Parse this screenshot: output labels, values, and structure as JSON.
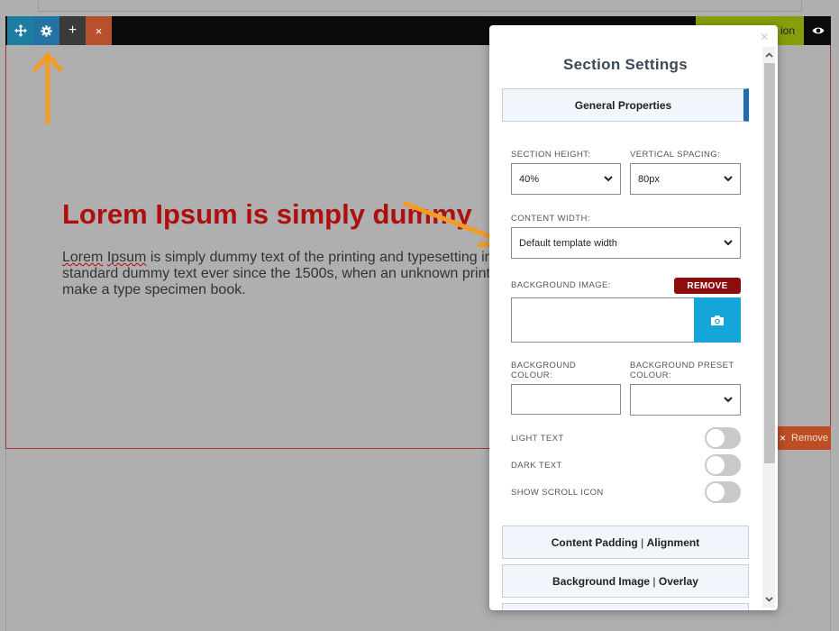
{
  "editor": {
    "toolbar": {
      "move_icon": "move-arrows-icon",
      "settings_icon": "gear-icon",
      "add_symbol": "+",
      "delete_symbol": "×",
      "add_section_label": "ion",
      "preview_icon": "eye-icon"
    },
    "hero": {
      "title": "Lorem Ipsum is simply dummy",
      "body_lines": [
        "Lorem Ipsum is simply dummy text of the printing and typesetting in",
        "standard dummy text ever since the 1500s, when an unknown print",
        "make a type specimen book."
      ]
    },
    "remove_block": {
      "x": "×",
      "label": "Remove"
    },
    "colors": {
      "toolbar": "#0b0b0b",
      "accent_arrow": "#f59a23",
      "title_red": "#ad0f0f",
      "overlay": "#afafaf"
    }
  },
  "modal": {
    "title": "Section Settings",
    "close_symbol": "×",
    "general_properties": "General Properties",
    "section_height": {
      "label": "SECTION HEIGHT:",
      "value": "40%"
    },
    "vertical_spacing": {
      "label": "VERTICAL SPACING:",
      "value": "80px"
    },
    "content_width": {
      "label": "CONTENT WIDTH:",
      "value": "Default template width"
    },
    "background_image": {
      "label": "BACKGROUND IMAGE:",
      "remove_label": "REMOVE"
    },
    "background_colour": {
      "label_line1": "BACKGROUND",
      "label_line2": "COLOUR:"
    },
    "background_preset": {
      "label_line1": "BACKGROUND PRESET",
      "label_line2": "COLOUR:"
    },
    "toggles": [
      {
        "label": "LIGHT TEXT",
        "on": false
      },
      {
        "label": "DARK TEXT",
        "on": false
      },
      {
        "label": "SHOW SCROLL ICON",
        "on": false
      }
    ],
    "content_padding": {
      "part1": "Content Padding",
      "sep": "|",
      "part2": "Alignment"
    },
    "background_overlay": {
      "part1": "Background Image",
      "sep": "|",
      "part2": "Overlay"
    },
    "colors": {
      "accent": "#1a6fb3",
      "remove": "#8c0d0d",
      "camera": "#14a6d8"
    }
  }
}
